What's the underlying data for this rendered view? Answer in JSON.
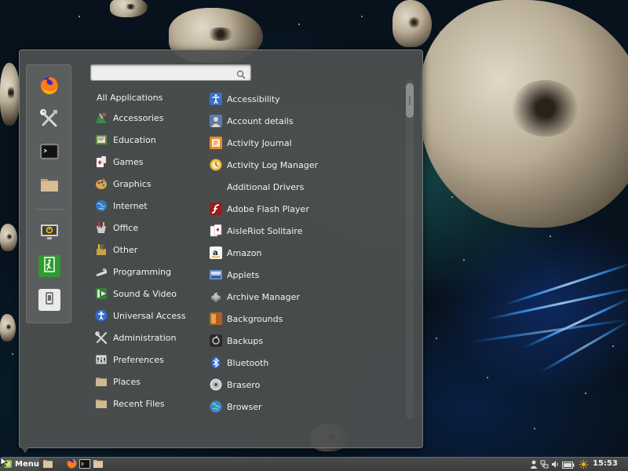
{
  "search": {
    "placeholder": "",
    "value": ""
  },
  "favorites": [
    {
      "name": "Firefox",
      "icon": "firefox-icon"
    },
    {
      "name": "System Settings",
      "icon": "tools-icon"
    },
    {
      "name": "Terminal",
      "icon": "terminal-icon"
    },
    {
      "name": "Files",
      "icon": "folder-icon"
    },
    {
      "name": "Lock Screen",
      "icon": "lock-screen-icon"
    },
    {
      "name": "Log Out",
      "icon": "logout-icon"
    },
    {
      "name": "Quit",
      "icon": "shutdown-icon"
    }
  ],
  "categories": [
    {
      "label": "All Applications",
      "icon": ""
    },
    {
      "label": "Accessories",
      "icon": "accessories-icon"
    },
    {
      "label": "Education",
      "icon": "education-icon"
    },
    {
      "label": "Games",
      "icon": "games-icon"
    },
    {
      "label": "Graphics",
      "icon": "graphics-icon"
    },
    {
      "label": "Internet",
      "icon": "internet-icon"
    },
    {
      "label": "Office",
      "icon": "office-icon"
    },
    {
      "label": "Other",
      "icon": "other-icon"
    },
    {
      "label": "Programming",
      "icon": "programming-icon"
    },
    {
      "label": "Sound & Video",
      "icon": "sound-video-icon"
    },
    {
      "label": "Universal Access",
      "icon": "universal-access-icon"
    },
    {
      "label": "Administration",
      "icon": "administration-icon"
    },
    {
      "label": "Preferences",
      "icon": "preferences-icon"
    },
    {
      "label": "Places",
      "icon": "places-folder-icon"
    },
    {
      "label": "Recent Files",
      "icon": "recent-files-folder-icon"
    }
  ],
  "apps": [
    {
      "label": "Accessibility",
      "icon": "accessibility-icon"
    },
    {
      "label": "Account details",
      "icon": "account-details-icon"
    },
    {
      "label": "Activity Journal",
      "icon": "activity-journal-icon"
    },
    {
      "label": "Activity Log Manager",
      "icon": "activity-log-manager-icon"
    },
    {
      "label": "Additional Drivers",
      "icon": ""
    },
    {
      "label": "Adobe Flash Player",
      "icon": "flash-player-icon"
    },
    {
      "label": "AisleRiot Solitaire",
      "icon": "solitaire-icon"
    },
    {
      "label": "Amazon",
      "icon": "amazon-icon"
    },
    {
      "label": "Applets",
      "icon": "applets-icon"
    },
    {
      "label": "Archive Manager",
      "icon": "archive-manager-icon"
    },
    {
      "label": "Backgrounds",
      "icon": "backgrounds-icon"
    },
    {
      "label": "Backups",
      "icon": "backups-icon"
    },
    {
      "label": "Bluetooth",
      "icon": "bluetooth-icon"
    },
    {
      "label": "Brasero",
      "icon": "brasero-icon"
    },
    {
      "label": "Browser",
      "icon": "browser-icon"
    }
  ],
  "taskbar": {
    "menu_label": "Menu",
    "clock": "15:53",
    "launchers": [
      "show-desktop-icon",
      "firefox-icon",
      "terminal-icon",
      "files-icon"
    ],
    "tray": [
      "user-icon",
      "network-icon",
      "volume-icon",
      "battery-icon",
      "update-sun-icon"
    ]
  },
  "colors": {
    "menu_bg": "#4e5050",
    "text": "#f2f2f2",
    "search_bg": "#eeeeee",
    "taskbar_bg": "#3b3d3d"
  }
}
